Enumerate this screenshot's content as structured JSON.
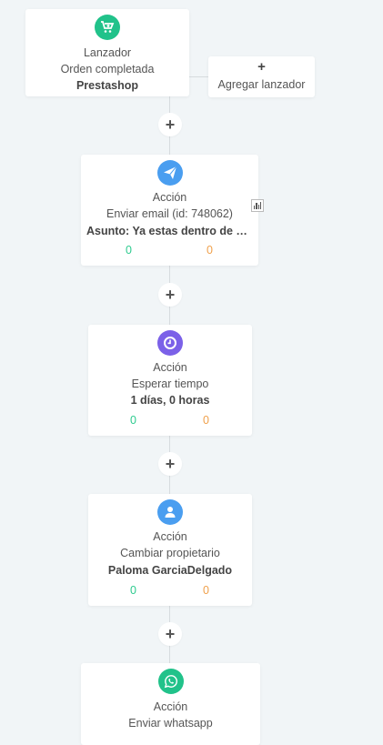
{
  "trigger": {
    "title": "Lanzador",
    "event": "Orden completada",
    "source": "Prestashop",
    "icon": "cart-icon",
    "color": "#21c28a"
  },
  "add_trigger": {
    "plus": "+",
    "label": "Agregar lanzador"
  },
  "connectors": {
    "plus": "+"
  },
  "actions": [
    {
      "title": "Acción",
      "subtitle": "Enviar email (id: 748062)",
      "detail": "Asunto: Ya estas dentro de nu...",
      "stat_green": "0",
      "stat_orange": "0",
      "icon": "paper-plane-icon",
      "color": "#4a9ef0"
    },
    {
      "title": "Acción",
      "subtitle": "Esperar tiempo",
      "detail": "1 días, 0 horas",
      "stat_green": "0",
      "stat_orange": "0",
      "icon": "clock-icon",
      "color": "#7b61e8"
    },
    {
      "title": "Acción",
      "subtitle": "Cambiar propietario",
      "detail": "Paloma GarciaDelgado",
      "stat_green": "0",
      "stat_orange": "0",
      "icon": "user-icon",
      "color": "#4a9ef0"
    },
    {
      "title": "Acción",
      "subtitle": "Enviar whatsapp",
      "icon": "whatsapp-icon",
      "color": "#21c28a"
    }
  ]
}
